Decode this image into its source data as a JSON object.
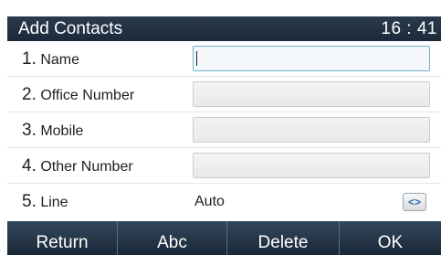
{
  "header": {
    "title": "Add Contacts",
    "time": "16 : 41"
  },
  "form": {
    "rows": [
      {
        "num": "1.",
        "label": "Name",
        "value": ""
      },
      {
        "num": "2.",
        "label": "Office Number",
        "value": ""
      },
      {
        "num": "3.",
        "label": "Mobile",
        "value": ""
      },
      {
        "num": "4.",
        "label": "Other Number",
        "value": ""
      },
      {
        "num": "5.",
        "label": "Line",
        "value": "Auto",
        "toggle_icon": "left-right-arrows-icon",
        "toggle_glyph": "<>"
      }
    ]
  },
  "softkeys": [
    {
      "label": "Return"
    },
    {
      "label": "Abc"
    },
    {
      "label": "Delete"
    },
    {
      "label": "OK"
    }
  ]
}
